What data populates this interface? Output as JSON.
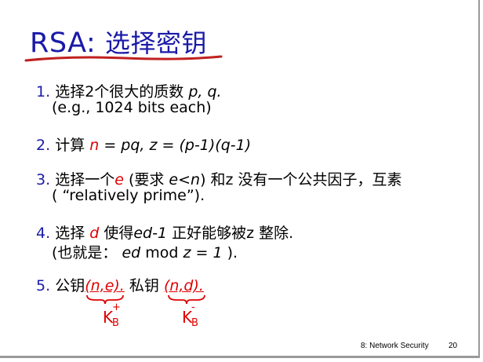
{
  "title": {
    "prefix": "RSA",
    "colon": ": ",
    "main": "选择密钥"
  },
  "items": [
    {
      "num": "1.",
      "line1": {
        "text": "选择2个很大的质数",
        "vars": "p, q."
      },
      "line2": "(e.g., 1024 bits each)"
    },
    {
      "num": "2.",
      "prefix": "计算",
      "n": "n",
      "eq1": " = pq,  z = (p-1)(q-1)"
    },
    {
      "num": "3.",
      "prefix": "选择一个",
      "e": "e",
      "mid": " (要求 ",
      "cond": "e<n",
      "rest": ") 和z 没有一个公共因子，互素",
      "line2": "( “relatively prime”)."
    },
    {
      "num": "4.",
      "prefix": "选择",
      "d": "d",
      "mid": " 使得",
      "ed": "ed-1",
      "rest": " 正好能够被z 整除.",
      "line2a": "(也就是：  ",
      "line2b": "ed",
      "line2c": " mod ",
      "line2d": "z  = 1",
      "line2e": " )."
    },
    {
      "num": "5.",
      "pub_label": "公钥",
      "pub": "(n,e).",
      "priv_label": " 私钥 ",
      "priv": "(n,d)."
    }
  ],
  "keys": {
    "public": {
      "letter": "K",
      "sup": "+",
      "sub": "B"
    },
    "private": {
      "letter": "K",
      "sup": "-",
      "sub": "B"
    }
  },
  "footer": {
    "course": "8: Network Security",
    "page": "20"
  },
  "colors": {
    "title": "#1a1aa8",
    "accent": "#e00000",
    "underline": "#c02020"
  }
}
